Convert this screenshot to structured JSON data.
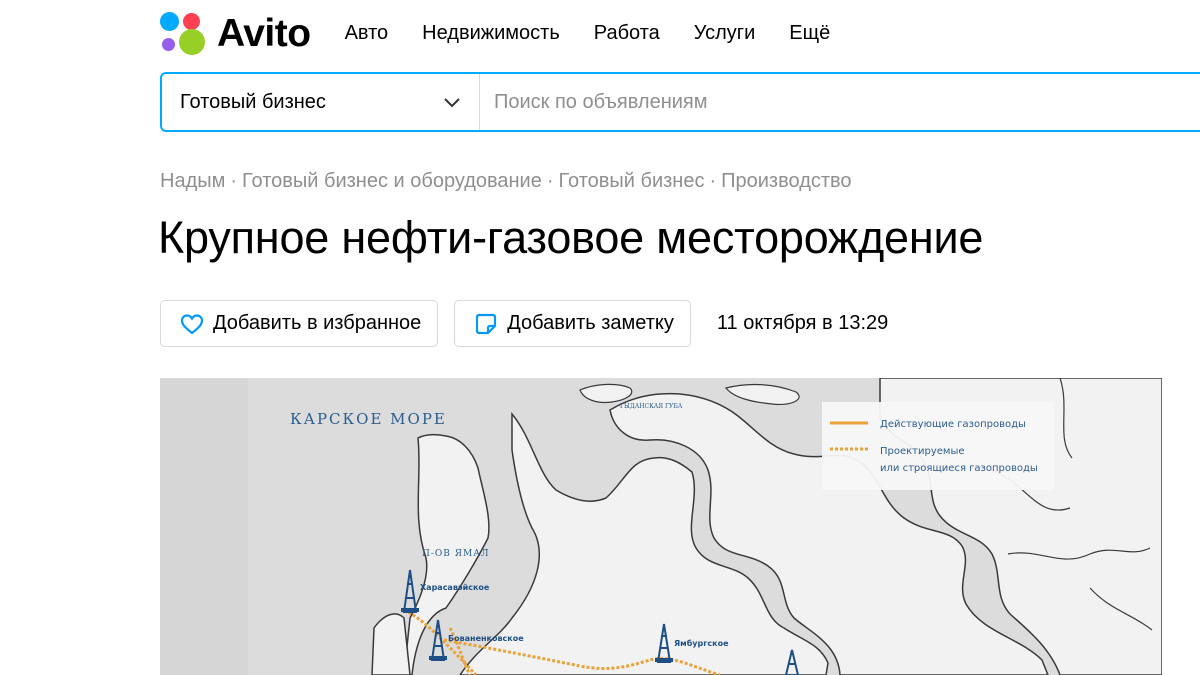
{
  "brand": {
    "name": "Avito"
  },
  "nav": {
    "items": [
      "Авто",
      "Недвижимость",
      "Работа",
      "Услуги",
      "Ещё"
    ]
  },
  "search": {
    "category": "Готовый бизнес",
    "placeholder": "Поиск по объявлениям"
  },
  "breadcrumbs": [
    "Надым",
    "Готовый бизнес и оборудование",
    "Готовый бизнес",
    "Производство"
  ],
  "listing": {
    "title": "Крупное нефти-газовое месторождение",
    "favorite_label": "Добавить в избранное",
    "note_label": "Добавить заметку",
    "date": "11 октября в 13:29"
  },
  "map": {
    "sea_label": "КАРСКОЕ МОРЕ",
    "peninsula_label": "П-ОВ ЯМАЛ",
    "bay_label": "ГЫДАНСКАЯ ГУБА",
    "legend": {
      "active": "Действующие газопроводы",
      "planned_line1": "Проектируемые",
      "planned_line2": "или строящиеся газопроводы"
    },
    "fields": [
      "Харасавэйское",
      "Бованенковское",
      "Ямбургское"
    ],
    "colors": {
      "pipeline": "#e8a33a",
      "water": "#d6d6d6",
      "land": "#f2f2f2",
      "coast": "#3a3a3a",
      "label": "#2b5d8f"
    }
  },
  "colors": {
    "accent": "#00aaff",
    "icon_blue": "#0099f7",
    "muted_text": "#8f8f8f"
  }
}
